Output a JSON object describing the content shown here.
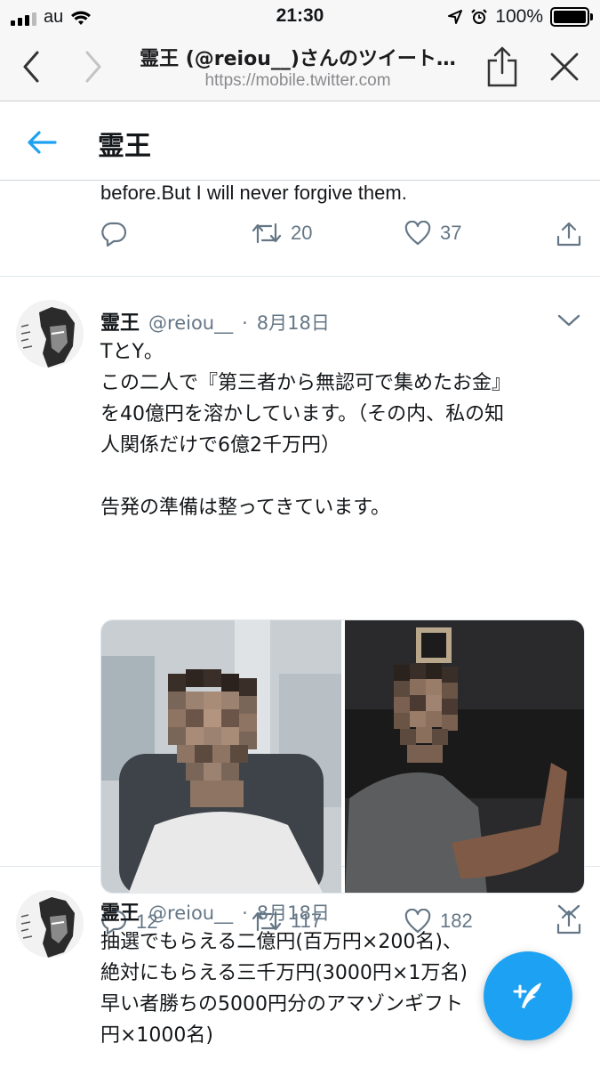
{
  "status_bar": {
    "carrier": "au",
    "time": "21:30",
    "battery": "100%"
  },
  "browser": {
    "page_title": "霊王 (@reiou__)さんのツイート…",
    "url": "https://mobile.twitter.com"
  },
  "header": {
    "title": "霊王"
  },
  "feed": {
    "partial_tweet": {
      "text": "before.But I will never forgive them.",
      "retweets": "20",
      "likes": "37"
    },
    "tweets": [
      {
        "name": "霊王",
        "handle": "@reiou__",
        "dot": "·",
        "date": "8月18日",
        "lines": [
          "TとY。",
          "この二人で『第三者から無認可で集めたお金』",
          "を40億円を溶かしています。（その内、私の知",
          "人関係だけで6億2千万円）",
          "",
          "告発の準備は整ってきています。"
        ],
        "replies": "12",
        "retweets": "117",
        "likes": "182"
      },
      {
        "name": "霊王",
        "handle": "@reiou__",
        "dot": "·",
        "date": "8月18日",
        "lines": [
          "抽選でもらえる二億円(百万円×200名)、",
          "絶対にもらえる三千万円(3000円×1万名)",
          "早い者勝ちの5000円分のアマゾンギフト",
          "円×1000名)"
        ]
      }
    ]
  },
  "colors": {
    "accent": "#1da1f2",
    "muted": "#657786",
    "divider": "#e1e8ed"
  },
  "icons": [
    "signal-icon",
    "wifi-icon",
    "location-icon",
    "alarm-icon",
    "battery-icon",
    "back-icon",
    "forward-icon",
    "share-icon",
    "close-icon",
    "arrow-left-icon",
    "reply-icon",
    "retweet-icon",
    "like-icon",
    "caret-down-icon",
    "compose-icon"
  ]
}
